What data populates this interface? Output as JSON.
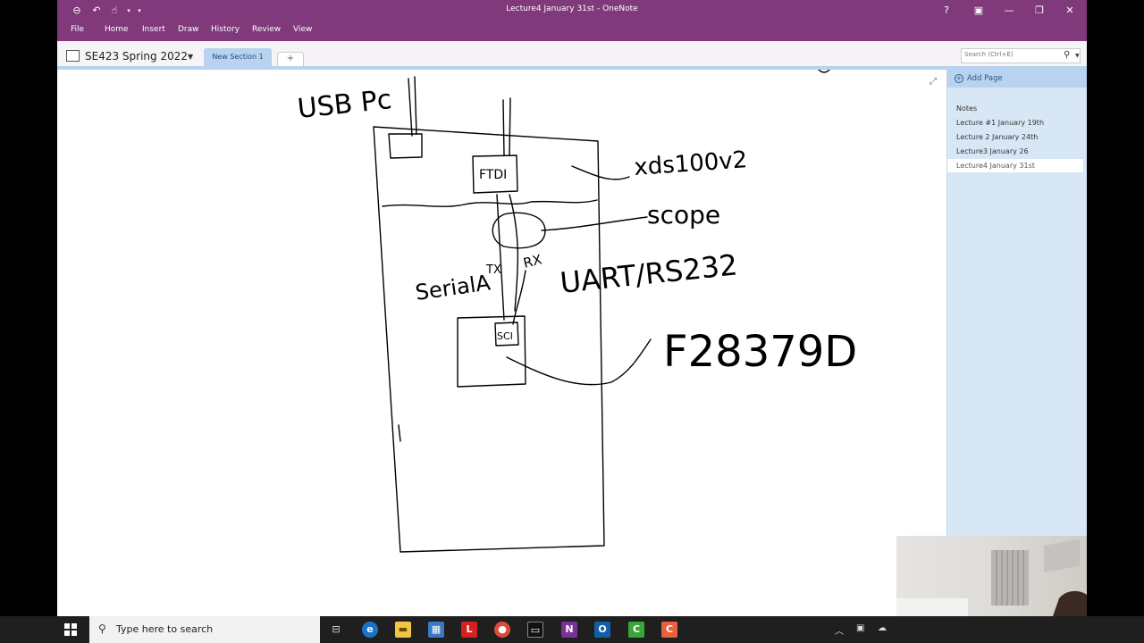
{
  "window": {
    "title": "Lecture4 January 31st - OneNote",
    "help_label": "?"
  },
  "ribbon": {
    "tabs": [
      "File",
      "Home",
      "Insert",
      "Draw",
      "History",
      "Review",
      "View"
    ]
  },
  "notebook": {
    "name": "SE423 Spring 2022",
    "section_tab": "New Section 1",
    "add_section_label": "+"
  },
  "search": {
    "placeholder": "Search (Ctrl+E)"
  },
  "page_pane": {
    "add_page_label": "Add Page",
    "pages": [
      "Notes",
      "Lecture #1 January 19th",
      "Lecture 2 January 24th",
      "Lecture3  January 26",
      "Lecture4 January 31st"
    ],
    "active_index": 4
  },
  "ink": {
    "usb_pc": "USB Pc",
    "ftdi": "FTDI",
    "xds": "xds100v2",
    "scope": "scope",
    "tx": "TX",
    "rx": "RX",
    "serial_a": "SerialA",
    "uart": "UART/RS232",
    "sci": "SCI",
    "chip": "F28379D"
  },
  "taskbar": {
    "search_text": "Type here to search"
  },
  "colors": {
    "onenote_purple": "#80397b",
    "section_blue": "#b7d3ef"
  }
}
